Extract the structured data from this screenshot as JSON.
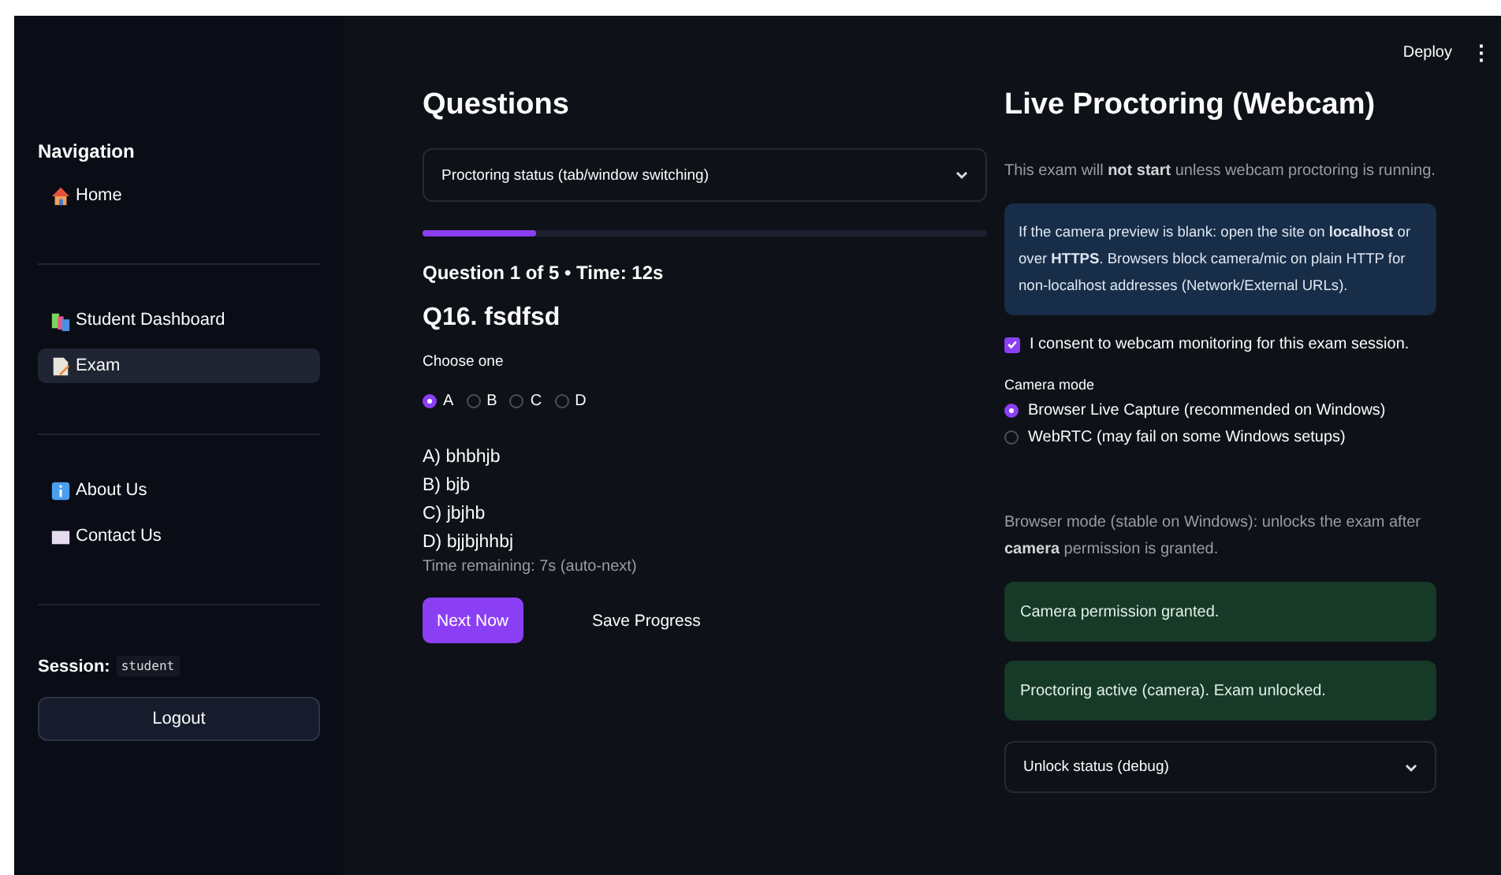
{
  "toolbar": {
    "deploy": "Deploy",
    "menu": "⋮"
  },
  "sidebar": {
    "heading": "Navigation",
    "groups": [
      [
        {
          "label": "Home",
          "kind": "house",
          "selected": false
        }
      ],
      [
        {
          "label": "Student Dashboard",
          "kind": "chart",
          "selected": false
        },
        {
          "label": "Exam",
          "kind": "page",
          "selected": true
        }
      ],
      [
        {
          "label": "About Us",
          "kind": "info",
          "selected": false
        },
        {
          "label": "Contact Us",
          "kind": "envelope",
          "selected": false
        }
      ]
    ],
    "session_label": "Session:",
    "session_user": "student",
    "logout": "Logout"
  },
  "questions": {
    "title": "Questions",
    "expander": {
      "label": "Proctoring status (tab/window switching)",
      "expanded": false
    },
    "progress": {
      "level": 0.2
    },
    "counter": "Question 1 of 5 • Time: 12s",
    "question": "Q16. fsdfsd",
    "prompt": "Choose one",
    "choices": [
      {
        "label": "A",
        "selected": true
      },
      {
        "label": "B",
        "selected": false
      },
      {
        "label": "C",
        "selected": false
      },
      {
        "label": "D",
        "selected": false
      }
    ],
    "answers": [
      "A) bhbhjb",
      "B) bjb",
      "C) jbjhb",
      "D) bjjbjhhbj"
    ],
    "timer": "Time remaining: 7s (auto-next)",
    "buttons": [
      {
        "label": "Next Now",
        "kind": "primary"
      },
      {
        "label": "Save Progress",
        "kind": "plain"
      }
    ]
  },
  "proctoring": {
    "title": "Live Proctoring (Webcam)",
    "note": "This exam will **not start** unless webcam proctoring is running.",
    "info": "If the camera preview is blank: open the site on **localhost** or over **HTTPS**. Browsers block camera/mic on plain HTTP for non-localhost addresses (Network/External URLs).",
    "consent": {
      "label": "I consent to webcam monitoring for this exam session.",
      "checked": true
    },
    "mode_label": "Camera mode",
    "modes": [
      {
        "label": "Browser Live Capture (recommended on Windows)",
        "selected": true
      },
      {
        "label": "WebRTC (may fail on some Windows setups)",
        "selected": false
      }
    ],
    "mode_note": "Browser mode (stable on Windows): unlocks the exam after **camera** permission is granted.",
    "alerts": [
      "Camera permission granted.",
      "Proctoring active (camera). Exam unlocked."
    ],
    "expander": {
      "label": "Unlock status (debug)",
      "expanded": false
    }
  }
}
